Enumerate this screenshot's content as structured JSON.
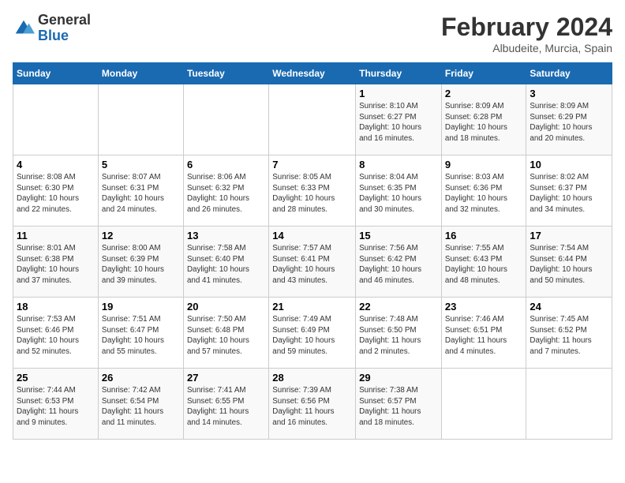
{
  "header": {
    "logo_line1": "General",
    "logo_line2": "Blue",
    "month_title": "February 2024",
    "subtitle": "Albudeite, Murcia, Spain"
  },
  "columns": [
    "Sunday",
    "Monday",
    "Tuesday",
    "Wednesday",
    "Thursday",
    "Friday",
    "Saturday"
  ],
  "weeks": [
    [
      {
        "day": "",
        "info": ""
      },
      {
        "day": "",
        "info": ""
      },
      {
        "day": "",
        "info": ""
      },
      {
        "day": "",
        "info": ""
      },
      {
        "day": "1",
        "info": "Sunrise: 8:10 AM\nSunset: 6:27 PM\nDaylight: 10 hours\nand 16 minutes."
      },
      {
        "day": "2",
        "info": "Sunrise: 8:09 AM\nSunset: 6:28 PM\nDaylight: 10 hours\nand 18 minutes."
      },
      {
        "day": "3",
        "info": "Sunrise: 8:09 AM\nSunset: 6:29 PM\nDaylight: 10 hours\nand 20 minutes."
      }
    ],
    [
      {
        "day": "4",
        "info": "Sunrise: 8:08 AM\nSunset: 6:30 PM\nDaylight: 10 hours\nand 22 minutes."
      },
      {
        "day": "5",
        "info": "Sunrise: 8:07 AM\nSunset: 6:31 PM\nDaylight: 10 hours\nand 24 minutes."
      },
      {
        "day": "6",
        "info": "Sunrise: 8:06 AM\nSunset: 6:32 PM\nDaylight: 10 hours\nand 26 minutes."
      },
      {
        "day": "7",
        "info": "Sunrise: 8:05 AM\nSunset: 6:33 PM\nDaylight: 10 hours\nand 28 minutes."
      },
      {
        "day": "8",
        "info": "Sunrise: 8:04 AM\nSunset: 6:35 PM\nDaylight: 10 hours\nand 30 minutes."
      },
      {
        "day": "9",
        "info": "Sunrise: 8:03 AM\nSunset: 6:36 PM\nDaylight: 10 hours\nand 32 minutes."
      },
      {
        "day": "10",
        "info": "Sunrise: 8:02 AM\nSunset: 6:37 PM\nDaylight: 10 hours\nand 34 minutes."
      }
    ],
    [
      {
        "day": "11",
        "info": "Sunrise: 8:01 AM\nSunset: 6:38 PM\nDaylight: 10 hours\nand 37 minutes."
      },
      {
        "day": "12",
        "info": "Sunrise: 8:00 AM\nSunset: 6:39 PM\nDaylight: 10 hours\nand 39 minutes."
      },
      {
        "day": "13",
        "info": "Sunrise: 7:58 AM\nSunset: 6:40 PM\nDaylight: 10 hours\nand 41 minutes."
      },
      {
        "day": "14",
        "info": "Sunrise: 7:57 AM\nSunset: 6:41 PM\nDaylight: 10 hours\nand 43 minutes."
      },
      {
        "day": "15",
        "info": "Sunrise: 7:56 AM\nSunset: 6:42 PM\nDaylight: 10 hours\nand 46 minutes."
      },
      {
        "day": "16",
        "info": "Sunrise: 7:55 AM\nSunset: 6:43 PM\nDaylight: 10 hours\nand 48 minutes."
      },
      {
        "day": "17",
        "info": "Sunrise: 7:54 AM\nSunset: 6:44 PM\nDaylight: 10 hours\nand 50 minutes."
      }
    ],
    [
      {
        "day": "18",
        "info": "Sunrise: 7:53 AM\nSunset: 6:46 PM\nDaylight: 10 hours\nand 52 minutes."
      },
      {
        "day": "19",
        "info": "Sunrise: 7:51 AM\nSunset: 6:47 PM\nDaylight: 10 hours\nand 55 minutes."
      },
      {
        "day": "20",
        "info": "Sunrise: 7:50 AM\nSunset: 6:48 PM\nDaylight: 10 hours\nand 57 minutes."
      },
      {
        "day": "21",
        "info": "Sunrise: 7:49 AM\nSunset: 6:49 PM\nDaylight: 10 hours\nand 59 minutes."
      },
      {
        "day": "22",
        "info": "Sunrise: 7:48 AM\nSunset: 6:50 PM\nDaylight: 11 hours\nand 2 minutes."
      },
      {
        "day": "23",
        "info": "Sunrise: 7:46 AM\nSunset: 6:51 PM\nDaylight: 11 hours\nand 4 minutes."
      },
      {
        "day": "24",
        "info": "Sunrise: 7:45 AM\nSunset: 6:52 PM\nDaylight: 11 hours\nand 7 minutes."
      }
    ],
    [
      {
        "day": "25",
        "info": "Sunrise: 7:44 AM\nSunset: 6:53 PM\nDaylight: 11 hours\nand 9 minutes."
      },
      {
        "day": "26",
        "info": "Sunrise: 7:42 AM\nSunset: 6:54 PM\nDaylight: 11 hours\nand 11 minutes."
      },
      {
        "day": "27",
        "info": "Sunrise: 7:41 AM\nSunset: 6:55 PM\nDaylight: 11 hours\nand 14 minutes."
      },
      {
        "day": "28",
        "info": "Sunrise: 7:39 AM\nSunset: 6:56 PM\nDaylight: 11 hours\nand 16 minutes."
      },
      {
        "day": "29",
        "info": "Sunrise: 7:38 AM\nSunset: 6:57 PM\nDaylight: 11 hours\nand 18 minutes."
      },
      {
        "day": "",
        "info": ""
      },
      {
        "day": "",
        "info": ""
      }
    ]
  ]
}
